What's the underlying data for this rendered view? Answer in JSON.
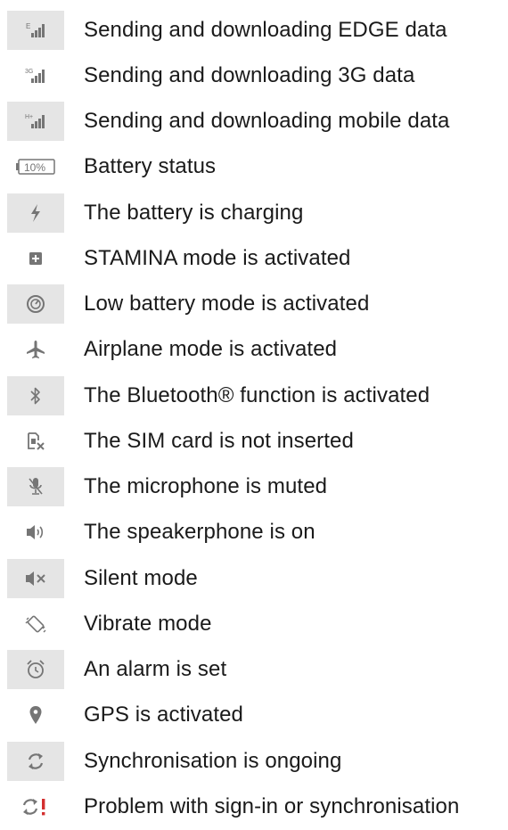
{
  "colors": {
    "text": "#1a1a1a",
    "icon": "#757575",
    "alert": "#d32f2f",
    "stripe": "#e5e5e5"
  },
  "items": [
    {
      "icon": "edge-signal-icon",
      "label": "Sending and downloading EDGE data",
      "icon_text": "E"
    },
    {
      "icon": "3g-signal-icon",
      "label": "Sending and downloading 3G data",
      "icon_text": "3G"
    },
    {
      "icon": "hplus-signal-icon",
      "label": "Sending and downloading mobile data",
      "icon_text": "H+"
    },
    {
      "icon": "battery-icon",
      "label": "Battery status",
      "icon_text": "10%"
    },
    {
      "icon": "charging-icon",
      "label": "The battery is charging"
    },
    {
      "icon": "stamina-icon",
      "label": "STAMINA mode is activated"
    },
    {
      "icon": "low-battery-mode-icon",
      "label": "Low battery mode is activated"
    },
    {
      "icon": "airplane-icon",
      "label": "Airplane mode is activated"
    },
    {
      "icon": "bluetooth-icon",
      "label": "The Bluetooth® function is activated"
    },
    {
      "icon": "no-sim-icon",
      "label": "The SIM card is not inserted"
    },
    {
      "icon": "mic-muted-icon",
      "label": "The microphone is muted"
    },
    {
      "icon": "speakerphone-icon",
      "label": "The speakerphone is on"
    },
    {
      "icon": "silent-icon",
      "label": "Silent mode"
    },
    {
      "icon": "vibrate-icon",
      "label": "Vibrate mode"
    },
    {
      "icon": "alarm-icon",
      "label": "An alarm is set"
    },
    {
      "icon": "gps-icon",
      "label": "GPS is activated"
    },
    {
      "icon": "sync-icon",
      "label": "Synchronisation is ongoing"
    },
    {
      "icon": "sync-problem-icon",
      "label": "Problem with sign-in or synchronisation"
    }
  ]
}
